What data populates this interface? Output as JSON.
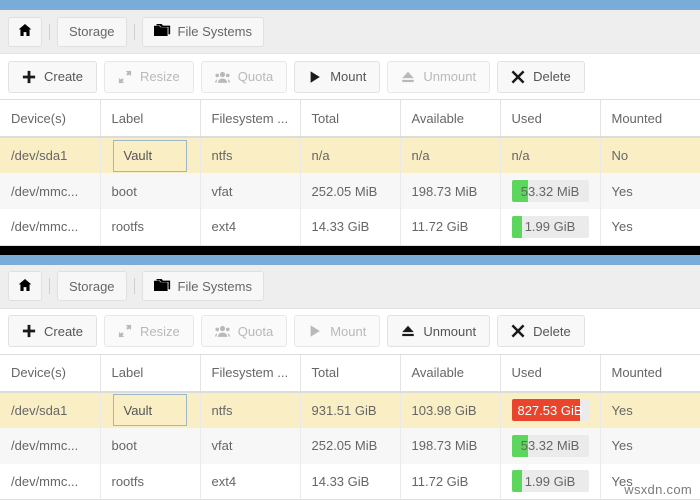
{
  "theme": {
    "accent_blue": "#7aacd9",
    "row_selected": "#faeec5",
    "bar_green": "#5cd65c",
    "bar_red": "#e8452c",
    "bar_track": "#ebebeb"
  },
  "watermark": "wsxdn.com",
  "panels": [
    {
      "breadcrumb": {
        "home_icon": "home-icon",
        "items": [
          {
            "label": "Storage",
            "icon": null
          },
          {
            "label": "File Systems",
            "icon": "folders-icon"
          }
        ]
      },
      "toolbar": [
        {
          "label": "Create",
          "icon": "plus-icon",
          "disabled": false
        },
        {
          "label": "Resize",
          "icon": "resize-icon",
          "disabled": true
        },
        {
          "label": "Quota",
          "icon": "users-icon",
          "disabled": true
        },
        {
          "label": "Mount",
          "icon": "play-icon",
          "disabled": false
        },
        {
          "label": "Unmount",
          "icon": "eject-icon",
          "disabled": true
        },
        {
          "label": "Delete",
          "icon": "x-icon",
          "disabled": false
        }
      ],
      "table": {
        "columns": [
          "Device(s)",
          "Label",
          "Filesystem ...",
          "Total",
          "Available",
          "Used",
          "Mounted"
        ],
        "rows": [
          {
            "device": "/dev/sda1",
            "label": "Vault",
            "fstype": "ntfs",
            "total": "n/a",
            "available": "n/a",
            "used_text": "n/a",
            "used_percent": null,
            "used_color": null,
            "mounted": "No",
            "selected": true,
            "label_editing": true
          },
          {
            "device": "/dev/mmc...",
            "label": "boot",
            "fstype": "vfat",
            "total": "252.05 MiB",
            "available": "198.73 MiB",
            "used_text": "53.32 MiB",
            "used_percent": 21,
            "used_color": "#5cd65c",
            "mounted": "Yes",
            "selected": false,
            "label_editing": false
          },
          {
            "device": "/dev/mmc...",
            "label": "rootfs",
            "fstype": "ext4",
            "total": "14.33 GiB",
            "available": "11.72 GiB",
            "used_text": "1.99 GiB",
            "used_percent": 14,
            "used_color": "#5cd65c",
            "mounted": "Yes",
            "selected": false,
            "label_editing": false
          }
        ]
      }
    },
    {
      "breadcrumb": {
        "home_icon": "home-icon",
        "items": [
          {
            "label": "Storage",
            "icon": null
          },
          {
            "label": "File Systems",
            "icon": "folders-icon"
          }
        ]
      },
      "toolbar": [
        {
          "label": "Create",
          "icon": "plus-icon",
          "disabled": false
        },
        {
          "label": "Resize",
          "icon": "resize-icon",
          "disabled": true
        },
        {
          "label": "Quota",
          "icon": "users-icon",
          "disabled": true
        },
        {
          "label": "Mount",
          "icon": "play-icon",
          "disabled": true
        },
        {
          "label": "Unmount",
          "icon": "eject-icon",
          "disabled": false
        },
        {
          "label": "Delete",
          "icon": "x-icon",
          "disabled": false
        }
      ],
      "table": {
        "columns": [
          "Device(s)",
          "Label",
          "Filesystem ...",
          "Total",
          "Available",
          "Used",
          "Mounted"
        ],
        "rows": [
          {
            "device": "/dev/sda1",
            "label": "Vault",
            "fstype": "ntfs",
            "total": "931.51 GiB",
            "available": "103.98 GiB",
            "used_text": "827.53 GiB",
            "used_percent": 89,
            "used_color": "#e8452c",
            "mounted": "Yes",
            "selected": true,
            "label_editing": true
          },
          {
            "device": "/dev/mmc...",
            "label": "boot",
            "fstype": "vfat",
            "total": "252.05 MiB",
            "available": "198.73 MiB",
            "used_text": "53.32 MiB",
            "used_percent": 21,
            "used_color": "#5cd65c",
            "mounted": "Yes",
            "selected": false,
            "label_editing": false
          },
          {
            "device": "/dev/mmc...",
            "label": "rootfs",
            "fstype": "ext4",
            "total": "14.33 GiB",
            "available": "11.72 GiB",
            "used_text": "1.99 GiB",
            "used_percent": 14,
            "used_color": "#5cd65c",
            "mounted": "Yes",
            "selected": false,
            "label_editing": false
          }
        ]
      }
    }
  ]
}
